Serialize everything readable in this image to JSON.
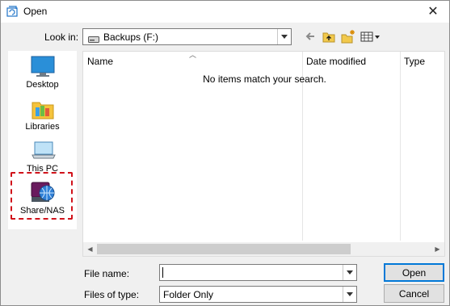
{
  "window": {
    "title": "Open",
    "close_icon": "close-icon"
  },
  "toolbar": {
    "look_in_label": "Look in:",
    "look_in_value": "Backups (F:)",
    "icons": [
      "back-arrow-icon",
      "up-folder-icon",
      "new-folder-icon",
      "view-menu-icon"
    ]
  },
  "places": [
    {
      "label": "Desktop",
      "icon": "desktop-icon"
    },
    {
      "label": "Libraries",
      "icon": "libraries-icon"
    },
    {
      "label": "This PC",
      "icon": "this-pc-icon"
    },
    {
      "label": "Share/NAS",
      "icon": "share-nas-icon"
    }
  ],
  "file_list": {
    "columns": [
      "Name",
      "Date modified",
      "Type"
    ],
    "empty_message": "No items match your search."
  },
  "form": {
    "file_name_label": "File name:",
    "file_name_value": "",
    "file_type_label": "Files of type:",
    "file_type_value": "Folder Only"
  },
  "buttons": {
    "open": "Open",
    "cancel": "Cancel"
  },
  "colors": {
    "highlight_dashed_border": "#d0121a",
    "default_button_border": "#0078d7"
  }
}
